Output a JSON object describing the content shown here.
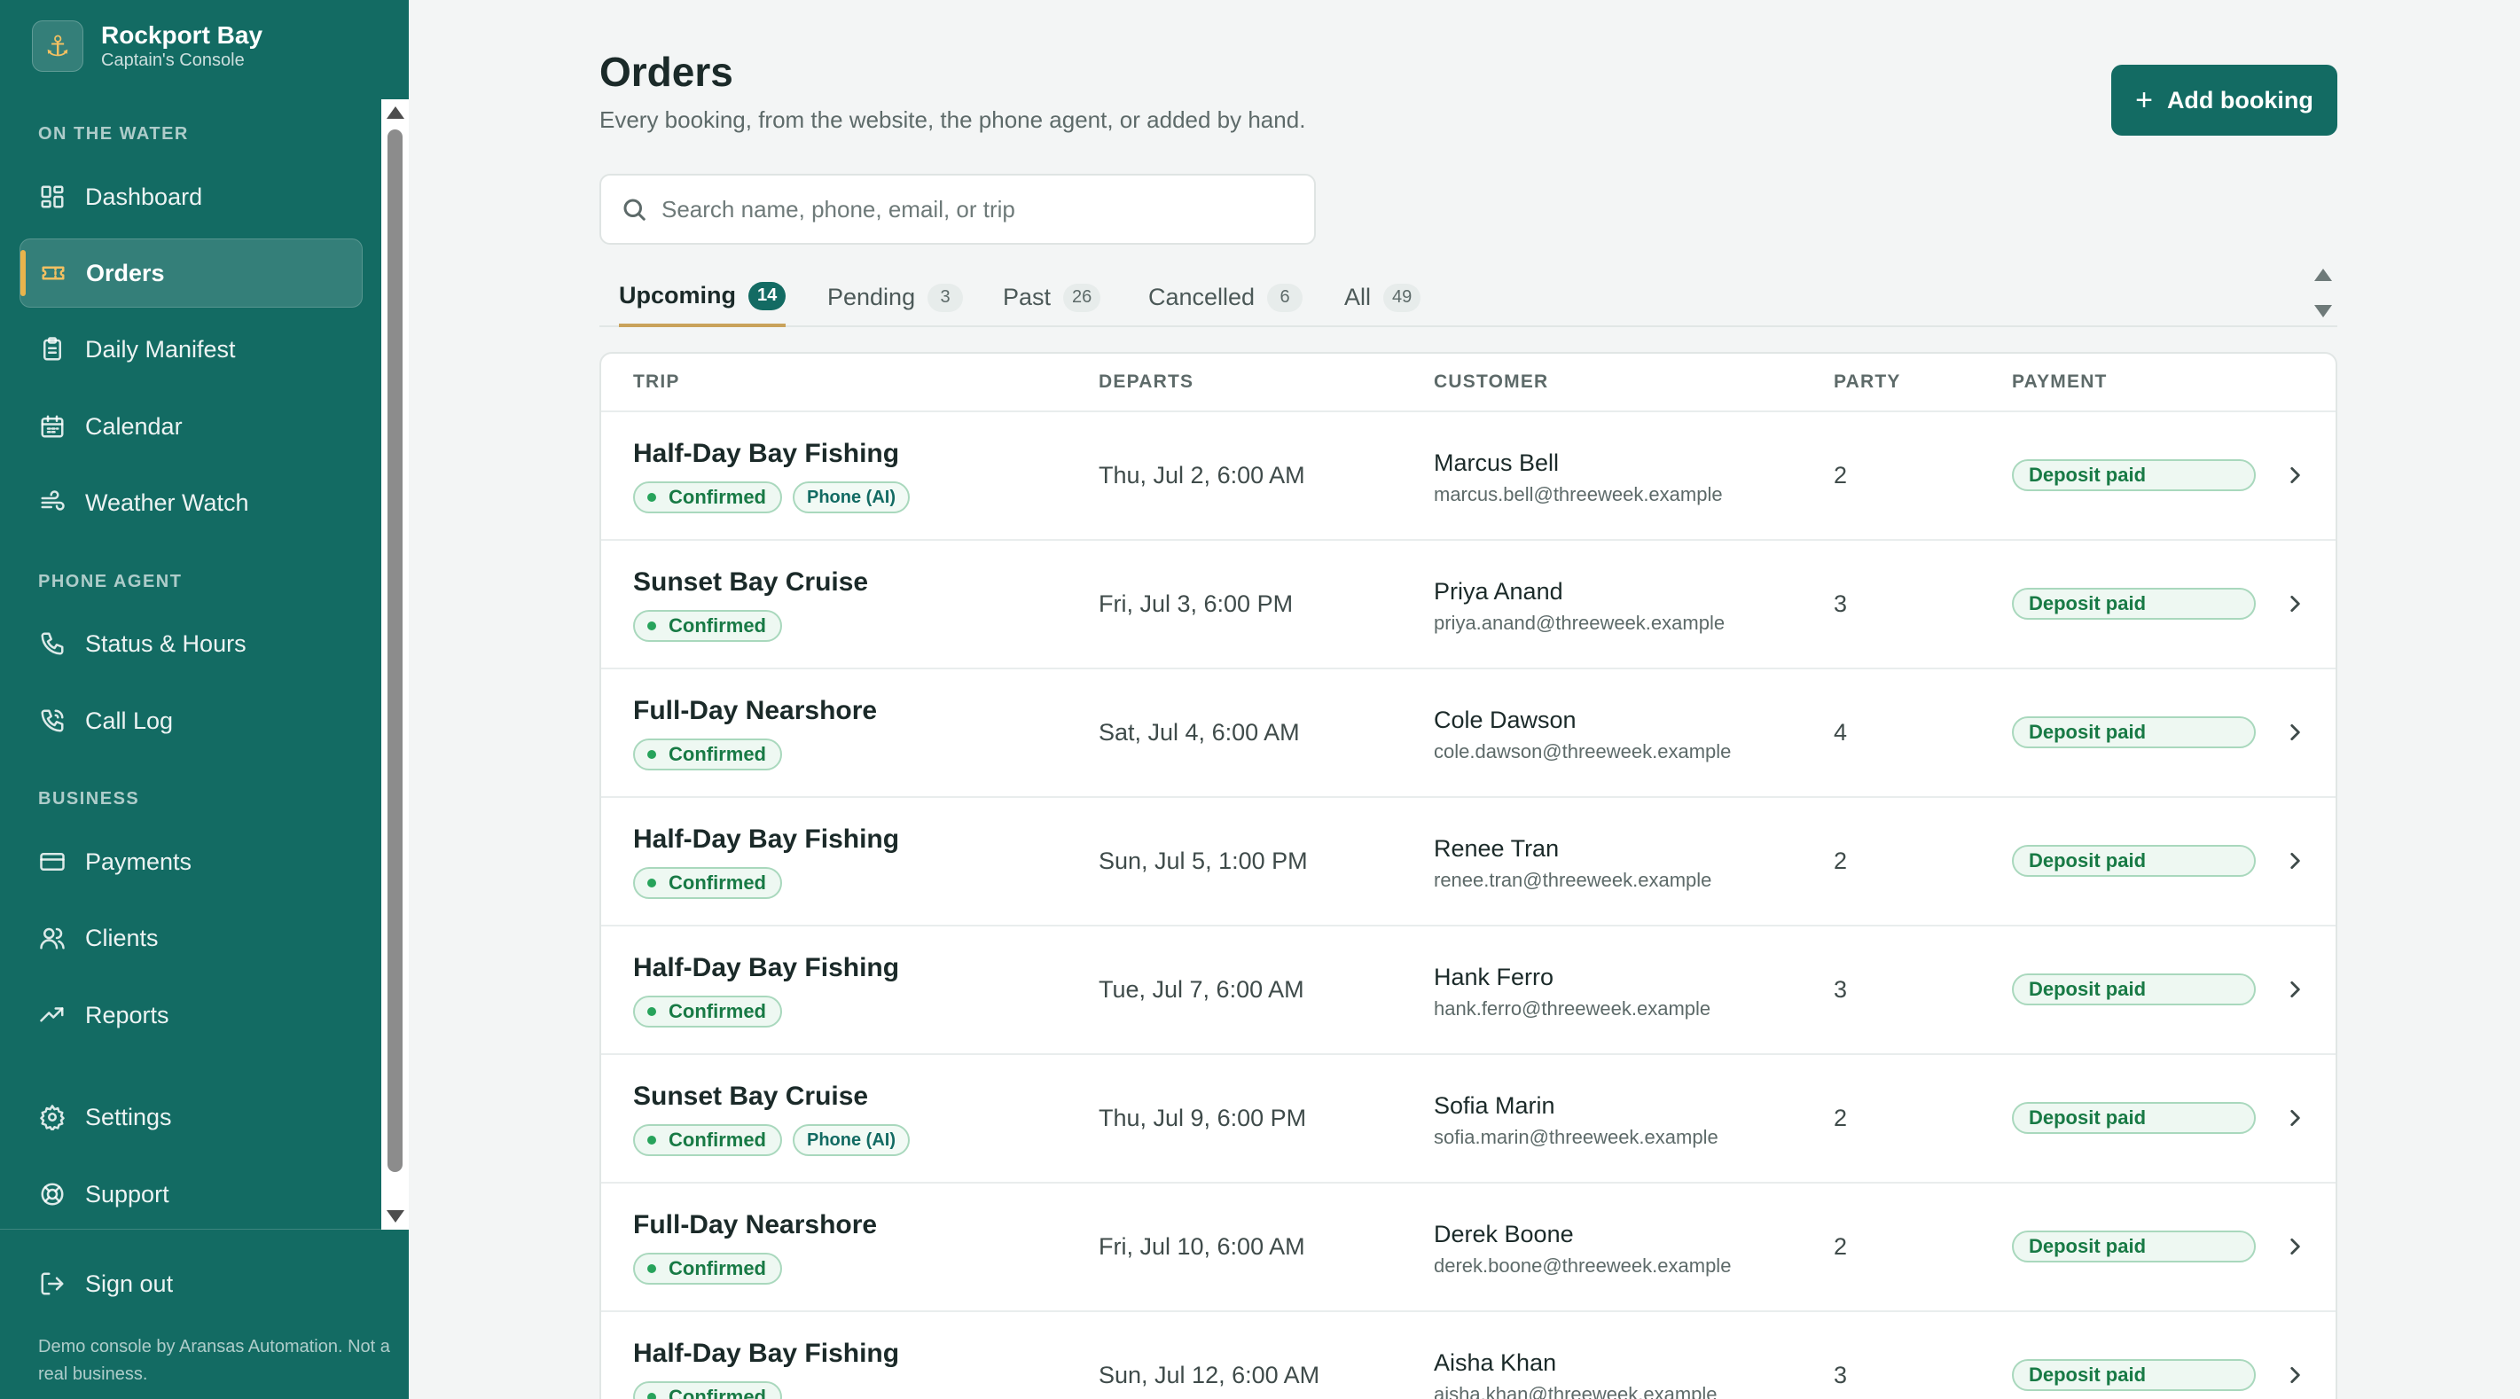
{
  "brand": {
    "name": "Rockport Bay",
    "subtitle": "Captain's Console"
  },
  "sidebar": {
    "sections": {
      "on_the_water": "ON THE WATER",
      "phone_agent": "PHONE AGENT",
      "business": "BUSINESS"
    },
    "items": {
      "dashboard": "Dashboard",
      "orders": "Orders",
      "daily_manifest": "Daily Manifest",
      "calendar": "Calendar",
      "weather_watch": "Weather Watch",
      "status_hours": "Status & Hours",
      "call_log": "Call Log",
      "payments": "Payments",
      "clients": "Clients",
      "reports": "Reports",
      "settings": "Settings",
      "support": "Support",
      "sign_out": "Sign out"
    },
    "footer": "Demo console by Aransas Automation. Not a real business."
  },
  "page": {
    "title": "Orders",
    "subtitle": "Every booking, from the website, the phone agent, or added by hand.",
    "add_button": "Add booking"
  },
  "search": {
    "placeholder": "Search name, phone, email, or trip",
    "value": ""
  },
  "tabs": [
    {
      "label": "Upcoming",
      "count": "14"
    },
    {
      "label": "Pending",
      "count": "3"
    },
    {
      "label": "Past",
      "count": "26"
    },
    {
      "label": "Cancelled",
      "count": "6"
    },
    {
      "label": "All",
      "count": "49"
    }
  ],
  "table": {
    "headers": {
      "trip": "TRIP",
      "departs": "DEPARTS",
      "customer": "CUSTOMER",
      "party": "PARTY",
      "payment": "PAYMENT"
    },
    "rows": [
      {
        "trip": "Half-Day Bay Fishing",
        "status": "Confirmed",
        "source": "Phone (AI)",
        "departs": "Thu, Jul 2, 6:00 AM",
        "name": "Marcus Bell",
        "email": "marcus.bell@threeweek.example",
        "party": "2",
        "payment": "Deposit paid"
      },
      {
        "trip": "Sunset Bay Cruise",
        "status": "Confirmed",
        "source": "",
        "departs": "Fri, Jul 3, 6:00 PM",
        "name": "Priya Anand",
        "email": "priya.anand@threeweek.example",
        "party": "3",
        "payment": "Deposit paid"
      },
      {
        "trip": "Full-Day Nearshore",
        "status": "Confirmed",
        "source": "",
        "departs": "Sat, Jul 4, 6:00 AM",
        "name": "Cole Dawson",
        "email": "cole.dawson@threeweek.example",
        "party": "4",
        "payment": "Deposit paid"
      },
      {
        "trip": "Half-Day Bay Fishing",
        "status": "Confirmed",
        "source": "",
        "departs": "Sun, Jul 5, 1:00 PM",
        "name": "Renee Tran",
        "email": "renee.tran@threeweek.example",
        "party": "2",
        "payment": "Deposit paid"
      },
      {
        "trip": "Half-Day Bay Fishing",
        "status": "Confirmed",
        "source": "",
        "departs": "Tue, Jul 7, 6:00 AM",
        "name": "Hank Ferro",
        "email": "hank.ferro@threeweek.example",
        "party": "3",
        "payment": "Deposit paid"
      },
      {
        "trip": "Sunset Bay Cruise",
        "status": "Confirmed",
        "source": "Phone (AI)",
        "departs": "Thu, Jul 9, 6:00 PM",
        "name": "Sofia Marin",
        "email": "sofia.marin@threeweek.example",
        "party": "2",
        "payment": "Deposit paid"
      },
      {
        "trip": "Full-Day Nearshore",
        "status": "Confirmed",
        "source": "",
        "departs": "Fri, Jul 10, 6:00 AM",
        "name": "Derek Boone",
        "email": "derek.boone@threeweek.example",
        "party": "2",
        "payment": "Deposit paid"
      },
      {
        "trip": "Half-Day Bay Fishing",
        "status": "Confirmed",
        "source": "",
        "departs": "Sun, Jul 12, 6:00 AM",
        "name": "Aisha Khan",
        "email": "aisha.khan@threeweek.example",
        "party": "3",
        "payment": "Deposit paid"
      }
    ]
  },
  "colors": {
    "brand": "#136b63",
    "accent": "#e9b44c",
    "success": "#187a45"
  },
  "icons": {
    "brand": "anchor-icon",
    "dashboard": "grid-icon",
    "orders": "ticket-icon",
    "manifest": "clipboard-icon",
    "calendar": "calendar-icon",
    "weather": "wind-icon",
    "status": "phone-icon",
    "call_log": "phone-call-icon",
    "payments": "credit-card-icon",
    "clients": "users-icon",
    "reports": "trending-up-icon",
    "settings": "gear-icon",
    "support": "lifebuoy-icon",
    "sign_out": "log-out-icon",
    "search": "search-icon",
    "add": "plus-icon",
    "row_open": "chevron-right-icon"
  }
}
